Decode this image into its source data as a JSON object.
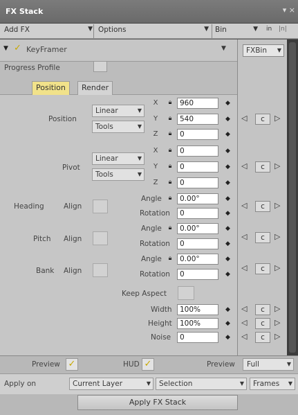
{
  "window": {
    "title": "FX Stack",
    "controls": "▾ ×"
  },
  "toolbar": {
    "add_fx": "Add FX",
    "options": "Options",
    "bin": "Bin",
    "icon1": "in",
    "icon2": "|n|"
  },
  "effect": {
    "name": "KeyFramer",
    "enabled": true,
    "progress_profile_label": "Progress Profile",
    "fxbin_label": "FXBin"
  },
  "tabs": [
    "Position",
    "Render"
  ],
  "active_tab": "Position",
  "position": {
    "label": "Position",
    "interp": "Linear",
    "tools": "Tools",
    "x": "960",
    "y": "540",
    "z": "0"
  },
  "pivot": {
    "label": "Pivot",
    "interp": "Linear",
    "tools": "Tools",
    "x": "0",
    "y": "0",
    "z": "0"
  },
  "heading": {
    "label": "Heading",
    "align": "Align",
    "angle_label": "Angle",
    "angle": "0.00°",
    "rotation_label": "Rotation",
    "rotation": "0"
  },
  "pitch": {
    "label": "Pitch",
    "align": "Align",
    "angle_label": "Angle",
    "angle": "0.00°",
    "rotation_label": "Rotation",
    "rotation": "0"
  },
  "bank": {
    "label": "Bank",
    "align": "Align",
    "angle_label": "Angle",
    "angle": "0.00°",
    "rotation_label": "Rotation",
    "rotation": "0"
  },
  "keep_aspect": {
    "label": "Keep Aspect"
  },
  "width": {
    "label": "Width",
    "value": "100%"
  },
  "height": {
    "label": "Height",
    "value": "100%"
  },
  "noise": {
    "label": "Noise",
    "value": "0"
  },
  "axis_labels": {
    "x": "X",
    "y": "Y",
    "z": "Z"
  },
  "kf": {
    "prev": "◁",
    "c": "c",
    "next": "▷"
  },
  "bottom": {
    "preview_label": "Preview",
    "hud_label": "HUD",
    "preview2_label": "Preview",
    "preview2_value": "Full"
  },
  "apply": {
    "apply_on_label": "Apply on",
    "layer": "Current Layer",
    "selection": "Selection",
    "frames": "Frames",
    "button": "Apply FX Stack"
  },
  "colors": {
    "accent_yellow": "#f1e28a",
    "check_yellow": "#c8a800"
  }
}
